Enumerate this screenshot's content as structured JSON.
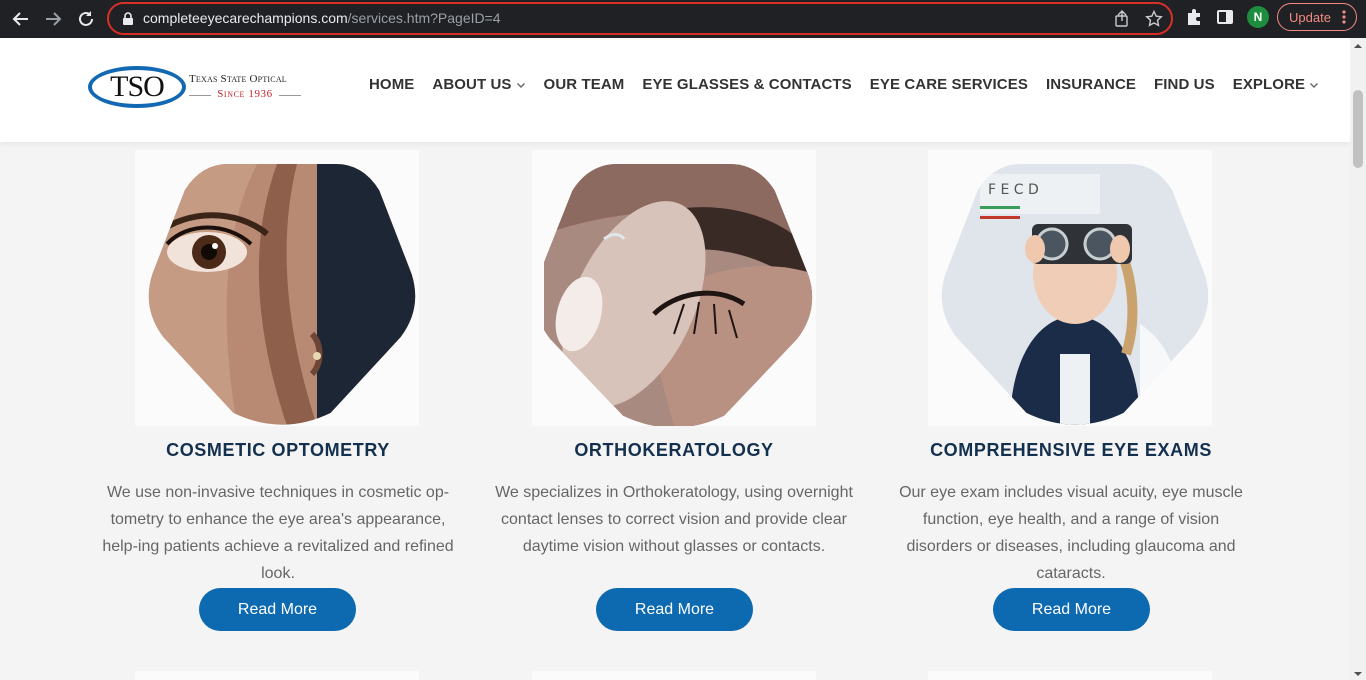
{
  "browser": {
    "url_domain": "completeeyecarechampions.com",
    "url_path": "/services.htm?PageID=4",
    "profile_initial": "N",
    "update_label": "Update"
  },
  "site": {
    "logo": {
      "mark": "TSO",
      "name": "Texas State Optical",
      "since": "Since 1936"
    },
    "nav": [
      {
        "label": "HOME",
        "dropdown": false
      },
      {
        "label": "ABOUT US",
        "dropdown": true
      },
      {
        "label": "OUR TEAM",
        "dropdown": false
      },
      {
        "label": "EYE GLASSES & CONTACTS",
        "dropdown": false
      },
      {
        "label": "EYE CARE SERVICES",
        "dropdown": false
      },
      {
        "label": "INSURANCE",
        "dropdown": false
      },
      {
        "label": "FIND US",
        "dropdown": false
      },
      {
        "label": "EXPLORE",
        "dropdown": true
      }
    ]
  },
  "services": [
    {
      "title": "COSMETIC OPTOMETRY",
      "text": "We use non-invasive techniques in cosmetic op-tometry to enhance the eye area's appearance, help-ing patients achieve a revitalized and refined look.",
      "button": "Read More"
    },
    {
      "title": "ORTHOKERATOLOGY",
      "text": "We specializes in Orthokeratology, using overnight contact lenses to correct vision and provide clear daytime vision without glasses or contacts.",
      "button": "Read More"
    },
    {
      "title": "COMPREHENSIVE EYE EXAMS",
      "text": "Our eye exam includes visual acuity, eye muscle function, eye health, and a range of vision disorders or diseases, including glaucoma and cataracts.",
      "button": "Read More"
    }
  ],
  "colors": {
    "brand_blue": "#0d69b0",
    "title_navy": "#14304f",
    "logo_red": "#c4262e"
  }
}
